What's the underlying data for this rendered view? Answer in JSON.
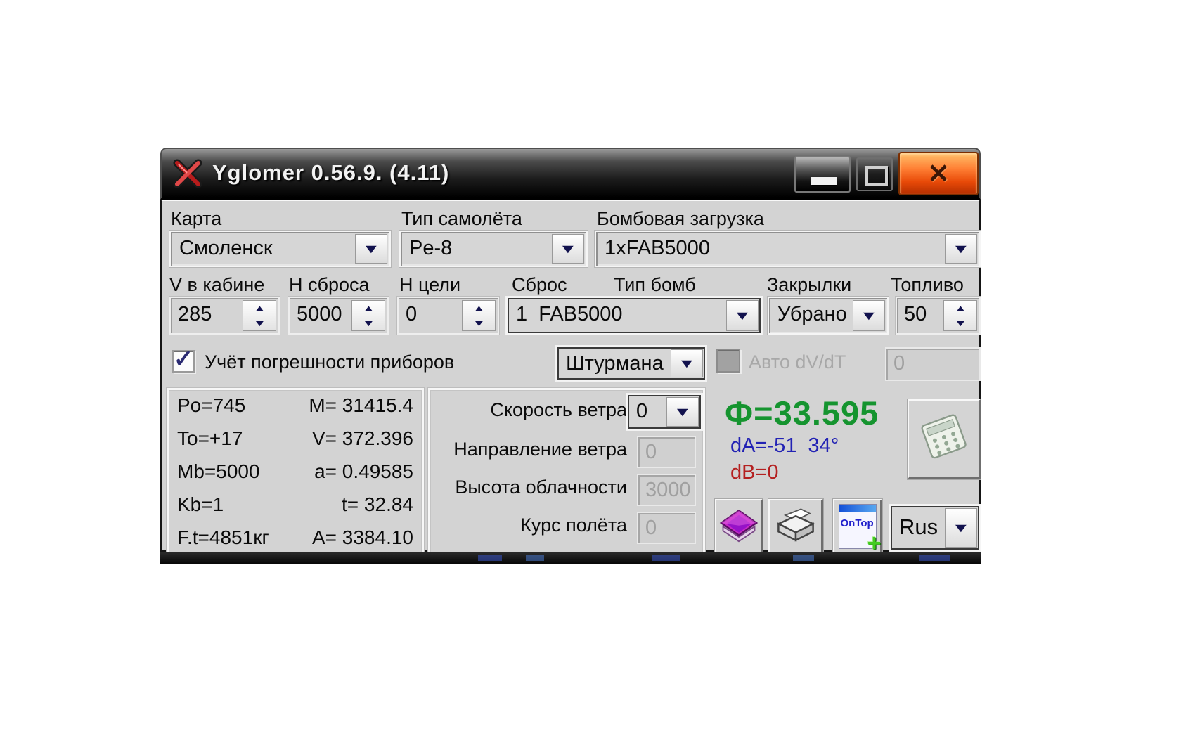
{
  "window": {
    "title": "Yglomer 0.56.9. (4.11)"
  },
  "icons": {
    "dropdown_arrow": "▼",
    "spin_up": "▲",
    "spin_down": "▼",
    "check": "✓",
    "close": "✕",
    "plus": "+"
  },
  "selectors": {
    "map": {
      "label": "Карта",
      "value": "Смоленск"
    },
    "aircraft": {
      "label": "Тип самолёта",
      "value": "Pe-8"
    },
    "bombload": {
      "label": "Бомбовая загрузка",
      "value": "1xFAB5000"
    }
  },
  "flight": {
    "v_cabin": {
      "label": "V в кабине",
      "value": "285"
    },
    "h_drop": {
      "label": "Н сброса",
      "value": "5000"
    },
    "h_target": {
      "label": "Н цели",
      "value": "0"
    },
    "drop": {
      "label": "Сброс"
    },
    "bomb_type": {
      "label": "Тип бомб",
      "value": "1  FAB5000"
    },
    "flaps": {
      "label": "Закрылки",
      "value": "Убрано"
    },
    "fuel": {
      "label": "Топливо",
      "value": "50"
    }
  },
  "options": {
    "instrument_error": {
      "label": "Учёт погрешности приборов",
      "checked": true
    },
    "crew_position": {
      "value": "Штурмана"
    },
    "auto_dvdt": {
      "label": "Авто dV/dT",
      "checked": false,
      "value": "0"
    }
  },
  "results": {
    "rows": [
      {
        "param": "Po=745",
        "value": "M= 31415.4"
      },
      {
        "param": "To=+17",
        "value": "V= 372.396"
      },
      {
        "param": "Mb=5000",
        "value": "a= 0.49585"
      },
      {
        "param": "Kb=1",
        "value": "t= 32.84"
      },
      {
        "param": "F.t=4851кг",
        "value": "A= 3384.10"
      }
    ]
  },
  "wind": {
    "speed": {
      "label": "Скорость ветра",
      "value": "0"
    },
    "direction": {
      "label": "Направление ветра",
      "value": "0"
    },
    "cloud_height": {
      "label": "Высота облачности",
      "value": "3000"
    },
    "course": {
      "label": "Курс полёта",
      "value": "0"
    }
  },
  "output": {
    "phi": "Ф=33.595",
    "dA": "dA=-51  34°",
    "dB": "dB=0",
    "colors": {
      "phi": "#15942f",
      "dA": "#2222b4",
      "dB": "#b42020"
    }
  },
  "buttons": {
    "ontop": "OnTop",
    "language": "Rus"
  }
}
